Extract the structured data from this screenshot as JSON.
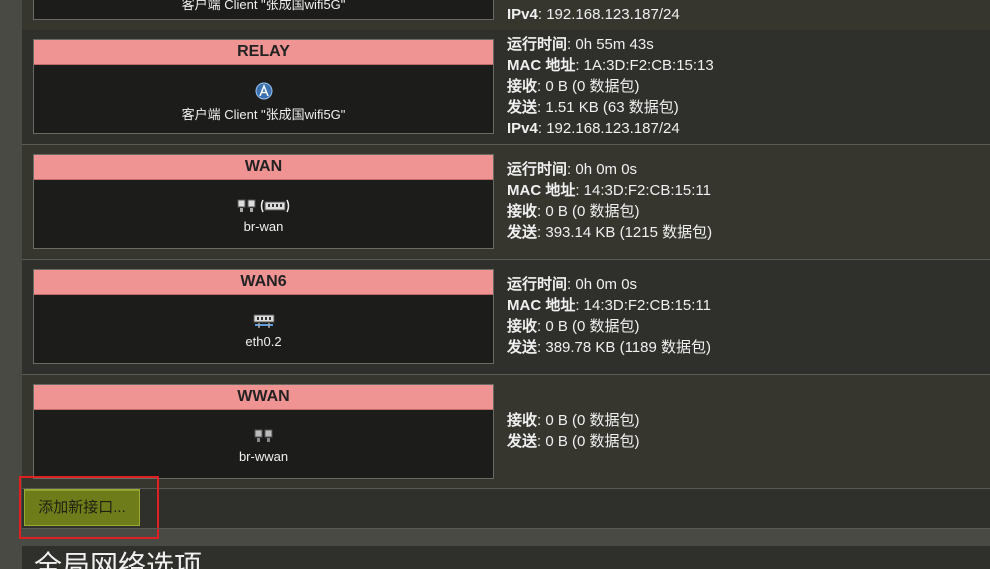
{
  "interfaces": [
    {
      "id": "top",
      "name": "",
      "label": "客户端 Client \"张成国wifi5G\"",
      "icons": [
        "wifi-icon"
      ],
      "info": [
        {
          "key": "IPv4",
          "value": "192.168.123.187/24"
        }
      ]
    },
    {
      "id": "relay",
      "name": "RELAY",
      "label": "客户端 Client \"张成国wifi5G\"",
      "icons": [
        "wifi-icon"
      ],
      "info": [
        {
          "key": "运行时间",
          "value": "0h 55m 43s"
        },
        {
          "key": "MAC 地址",
          "value": "1A:3D:F2:CB:15:13"
        },
        {
          "key": "接收",
          "value": "0 B (0 数据包)"
        },
        {
          "key": "发送",
          "value": "1.51 KB (63 数据包)"
        },
        {
          "key": "IPv4",
          "value": "192.168.123.187/24"
        }
      ]
    },
    {
      "id": "wan",
      "name": "WAN",
      "label": "br-wan",
      "icons": [
        "bridge-icon",
        "ethernet-icon"
      ],
      "info": [
        {
          "key": "运行时间",
          "value": "0h 0m 0s"
        },
        {
          "key": "MAC 地址",
          "value": "14:3D:F2:CB:15:11"
        },
        {
          "key": "接收",
          "value": "0 B (0 数据包)"
        },
        {
          "key": "发送",
          "value": "393.14 KB (1215 数据包)"
        }
      ]
    },
    {
      "id": "wan6",
      "name": "WAN6",
      "label": "eth0.2",
      "icons": [
        "vlan-icon"
      ],
      "info": [
        {
          "key": "运行时间",
          "value": "0h 0m 0s"
        },
        {
          "key": "MAC 地址",
          "value": "14:3D:F2:CB:15:11"
        },
        {
          "key": "接收",
          "value": "0 B (0 数据包)"
        },
        {
          "key": "发送",
          "value": "389.78 KB (1189 数据包)"
        }
      ]
    },
    {
      "id": "wwan",
      "name": "WWAN",
      "label": "br-wwan",
      "icons": [
        "bridge-icon"
      ],
      "info": [
        {
          "key": "接收",
          "value": "0 B (0 数据包)"
        },
        {
          "key": "发送",
          "value": "0 B (0 数据包)"
        }
      ]
    }
  ],
  "add_button": {
    "label": "添加新接口..."
  },
  "global_section": {
    "title": "全局网络选项"
  },
  "colors": {
    "card_header": "#f09393",
    "add_button": "#6e7d1a",
    "highlight": "#e02020"
  }
}
